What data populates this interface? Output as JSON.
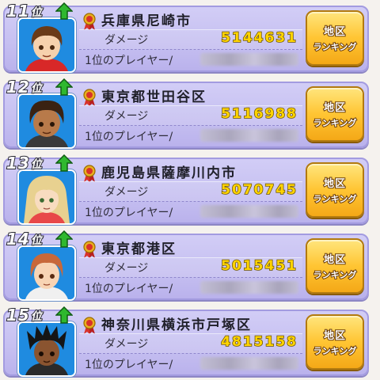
{
  "labels": {
    "damage": "ダメージ",
    "player": "1位のプレイヤー/",
    "rank_suffix": "位",
    "button_line1": "地区",
    "button_line2": "ランキング"
  },
  "entries": [
    {
      "rank": "11",
      "region": "兵庫県尼崎市",
      "damage": "5144631",
      "trend": "up",
      "avatar": "brown-hair-red-shirt"
    },
    {
      "rank": "12",
      "region": "東京都世田谷区",
      "damage": "5116988",
      "trend": "up",
      "avatar": "dark-curly-hair"
    },
    {
      "rank": "13",
      "region": "鹿児島県薩摩川内市",
      "damage": "5070745",
      "trend": "up",
      "avatar": "long-blonde-hair"
    },
    {
      "rank": "14",
      "region": "東京都港区",
      "damage": "5015451",
      "trend": "up",
      "avatar": "auburn-hair"
    },
    {
      "rank": "15",
      "region": "神奈川県横浜市戸塚区",
      "damage": "4815158",
      "trend": "up",
      "avatar": "spiky-black-hair"
    }
  ],
  "colors": {
    "card": "#c6c0f1",
    "button": "#ffc533",
    "damage_text": "#ffd400",
    "avatar_bg": "#1f8be0",
    "arrow": "#2fb82f",
    "medal": "#d8322a"
  },
  "icons": {
    "trend": "up-arrow-icon",
    "region": "medal-icon"
  }
}
